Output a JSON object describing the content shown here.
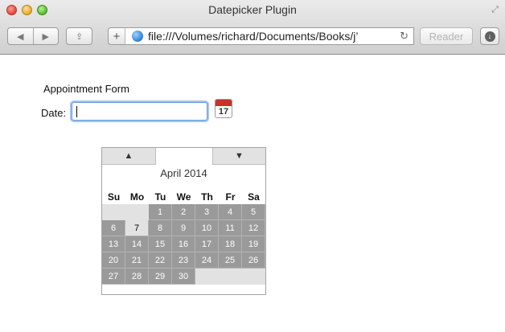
{
  "window": {
    "title": "Datepicker Plugin",
    "url": "file:///Volumes/richard/Documents/Books/j’",
    "reader_label": "Reader",
    "plus_label": "+"
  },
  "form": {
    "title": "Appointment Form",
    "date_label": "Date:",
    "date_value": "",
    "calendar_icon_number": "17"
  },
  "datepicker": {
    "month_year": "April 2014",
    "weekdays": [
      "Su",
      "Mo",
      "Tu",
      "We",
      "Th",
      "Fr",
      "Sa"
    ],
    "weeks": [
      [
        "",
        "",
        "1",
        "2",
        "3",
        "4",
        "5"
      ],
      [
        "6",
        "7",
        "8",
        "9",
        "10",
        "11",
        "12"
      ],
      [
        "13",
        "14",
        "15",
        "16",
        "17",
        "18",
        "19"
      ],
      [
        "20",
        "21",
        "22",
        "23",
        "24",
        "25",
        "26"
      ],
      [
        "27",
        "28",
        "29",
        "30",
        "",
        "",
        ""
      ]
    ],
    "highlighted_day": "7"
  },
  "colors": {
    "day_cell_bg": "#9a9a9a",
    "highlight_bg": "#e2e2e2",
    "input_focus": "#9ec4f2",
    "calendar_icon_red": "#cf2f2b"
  },
  "icons": {
    "close": "close-icon",
    "minimize": "minimize-icon",
    "zoom": "zoom-icon",
    "back": "back-icon",
    "forward": "forward-icon",
    "share": "share-icon",
    "globe": "globe-icon",
    "reload": "reload-icon",
    "download": "download-icon",
    "calendar": "calendar-icon",
    "prev_month": "triangle-up-icon",
    "next_month": "triangle-down-icon"
  }
}
